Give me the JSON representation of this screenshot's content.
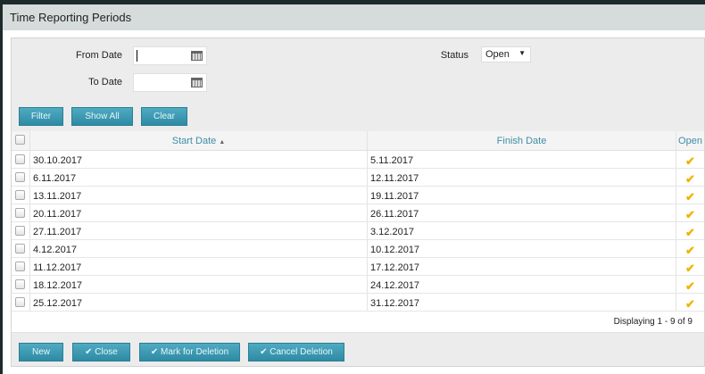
{
  "header": {
    "title": "Time Reporting Periods"
  },
  "filters": {
    "from_date_label": "From Date",
    "from_date_value": "",
    "to_date_label": "To Date",
    "to_date_value": "",
    "status_label": "Status",
    "status_value": "Open"
  },
  "filter_buttons": {
    "filter": "Filter",
    "show_all": "Show All",
    "clear": "Clear"
  },
  "table": {
    "columns": {
      "start": "Start Date",
      "start_sort": "▲",
      "finish": "Finish Date",
      "open": "Open"
    },
    "rows": [
      {
        "start": "30.10.2017",
        "finish": "5.11.2017"
      },
      {
        "start": "6.11.2017",
        "finish": "12.11.2017"
      },
      {
        "start": "13.11.2017",
        "finish": "19.11.2017"
      },
      {
        "start": "20.11.2017",
        "finish": "26.11.2017"
      },
      {
        "start": "27.11.2017",
        "finish": "3.12.2017"
      },
      {
        "start": "4.12.2017",
        "finish": "10.12.2017"
      },
      {
        "start": "11.12.2017",
        "finish": "17.12.2017"
      },
      {
        "start": "18.12.2017",
        "finish": "24.12.2017"
      },
      {
        "start": "25.12.2017",
        "finish": "31.12.2017"
      }
    ],
    "footer": "Displaying 1 - 9 of 9"
  },
  "actions": {
    "new": "New",
    "close": "✔ Close",
    "mark": "✔ Mark for Deletion",
    "cancel": "✔ Cancel Deletion"
  }
}
